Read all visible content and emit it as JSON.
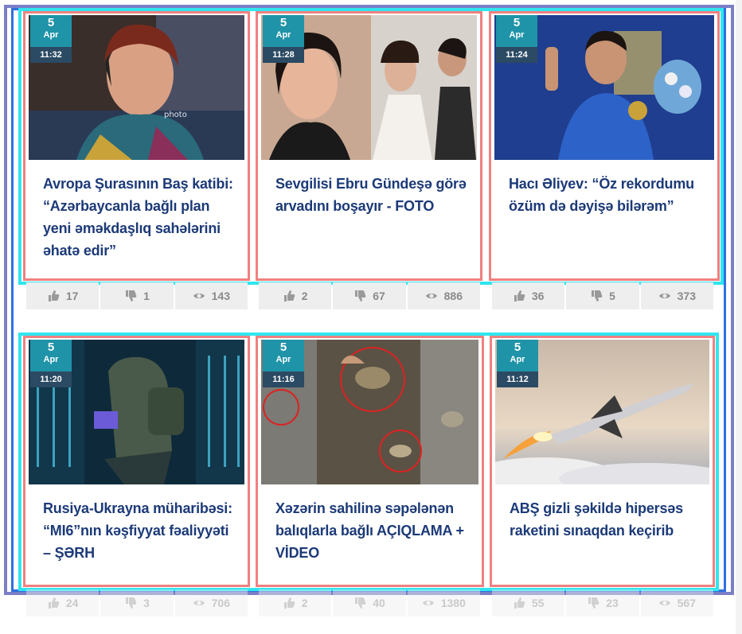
{
  "cards": [
    {
      "day": "5",
      "month": "Apr",
      "time": "11:32",
      "title": "Avropa Şurasının Baş katibi: “Azərbaycanla bağlı plan yeni əməkdaşlıq sahələrini əhatə edir”",
      "likes": "17",
      "dislikes": "1",
      "views": "143",
      "image": "portrait-woman-headphones"
    },
    {
      "day": "5",
      "month": "Apr",
      "time": "11:28",
      "title": "Sevgilisi Ebru Gündeşə görə arvadını boşayır - FOTO",
      "likes": "2",
      "dislikes": "67",
      "views": "886",
      "image": "couple-wedding"
    },
    {
      "day": "5",
      "month": "Apr",
      "time": "11:24",
      "title": "Hacı Əliyev: “Öz rekordumu özüm də dəyişə bilərəm”",
      "likes": "36",
      "dislikes": "5",
      "views": "373",
      "image": "wrestler-medal"
    },
    {
      "day": "5",
      "month": "Apr",
      "time": "11:20",
      "title": "Rusiya-Ukrayna müharibəsi: “MI6”nın kəşfiyyat fəaliyyəti – ŞƏRH",
      "likes": "24",
      "dislikes": "3",
      "views": "706",
      "image": "hacker-server-room"
    },
    {
      "day": "5",
      "month": "Apr",
      "time": "11:16",
      "title": "Xəzərin sahilinə səpələnən balıqlarla bağlı AÇIQLAMA + VİDEO",
      "likes": "2",
      "dislikes": "40",
      "views": "1380",
      "image": "dead-fish-shore"
    },
    {
      "day": "5",
      "month": "Apr",
      "time": "11:12",
      "title": "ABŞ gizli şəkildə hipersəs raketini sınaqdan keçirib",
      "likes": "55",
      "dislikes": "23",
      "views": "567",
      "image": "hypersonic-missile"
    }
  ],
  "colors": {
    "accent": "#1f93a8",
    "title": "#1c3a78",
    "timeBg": "#2b4a63"
  }
}
